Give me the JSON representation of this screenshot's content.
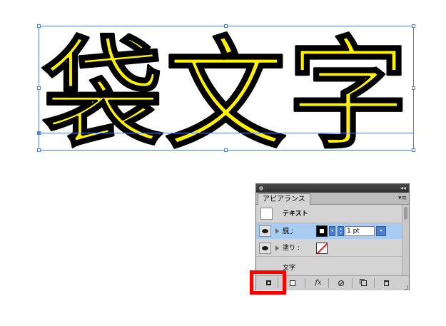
{
  "artwork": {
    "text": "袋文字",
    "fill_color": "#FFF200",
    "stroke_color": "#000000",
    "selection_color": "#5B7FD6"
  },
  "panel": {
    "tab_label": "アピアランス",
    "menu_glyph": "▾≡",
    "collapse_glyph": "◂◂",
    "object_label": "テキスト",
    "stroke": {
      "label": "線 :",
      "weight_value": "1 pt",
      "color": "#000000"
    },
    "fill": {
      "label": "塗り :",
      "color": "none"
    },
    "character_label": "文字",
    "toolbar": {
      "fx_label": "fx"
    }
  },
  "highlight": {
    "color": "#FF0000",
    "target": "add-new-stroke-button"
  }
}
